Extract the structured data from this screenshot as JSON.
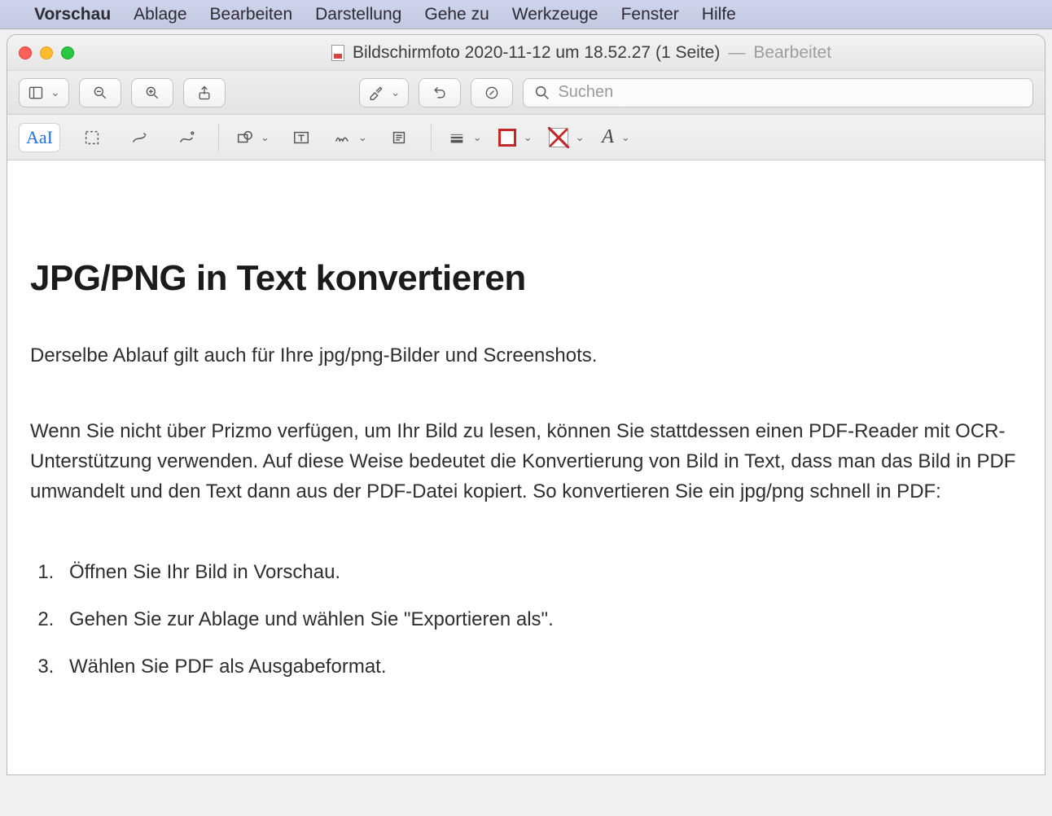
{
  "menubar": {
    "app": "Vorschau",
    "items": [
      "Ablage",
      "Bearbeiten",
      "Darstellung",
      "Gehe zu",
      "Werkzeuge",
      "Fenster",
      "Hilfe"
    ]
  },
  "window": {
    "title": "Bildschirmfoto 2020-11-12 um 18.52.27 (1 Seite)",
    "separator": "—",
    "edited": "Bearbeitet"
  },
  "toolbar": {
    "search_placeholder": "Suchen"
  },
  "markup": {
    "text_tool_label": "AaI",
    "font_label": "A"
  },
  "document": {
    "heading": "JPG/PNG in Text konvertieren",
    "lead": "Derselbe Ablauf gilt auch für Ihre jpg/png-Bilder und Screenshots.",
    "body": "Wenn Sie nicht über Prizmo verfügen, um Ihr Bild zu lesen, können Sie stattdessen einen PDF-Reader mit OCR-Unterstützung verwenden. Auf diese Weise bedeutet die Konvertierung von Bild in Text, dass man das Bild in PDF umwandelt und den Text dann aus der PDF-Datei kopiert. So konvertieren Sie ein jpg/png schnell in PDF:",
    "steps": [
      "Öffnen Sie Ihr Bild in Vorschau.",
      "Gehen Sie zur Ablage und wählen Sie \"Exportieren als\".",
      "Wählen Sie PDF als Ausgabeformat."
    ]
  },
  "colors": {
    "accent": "#1e6fe6",
    "stroke_color": "#c62828"
  }
}
